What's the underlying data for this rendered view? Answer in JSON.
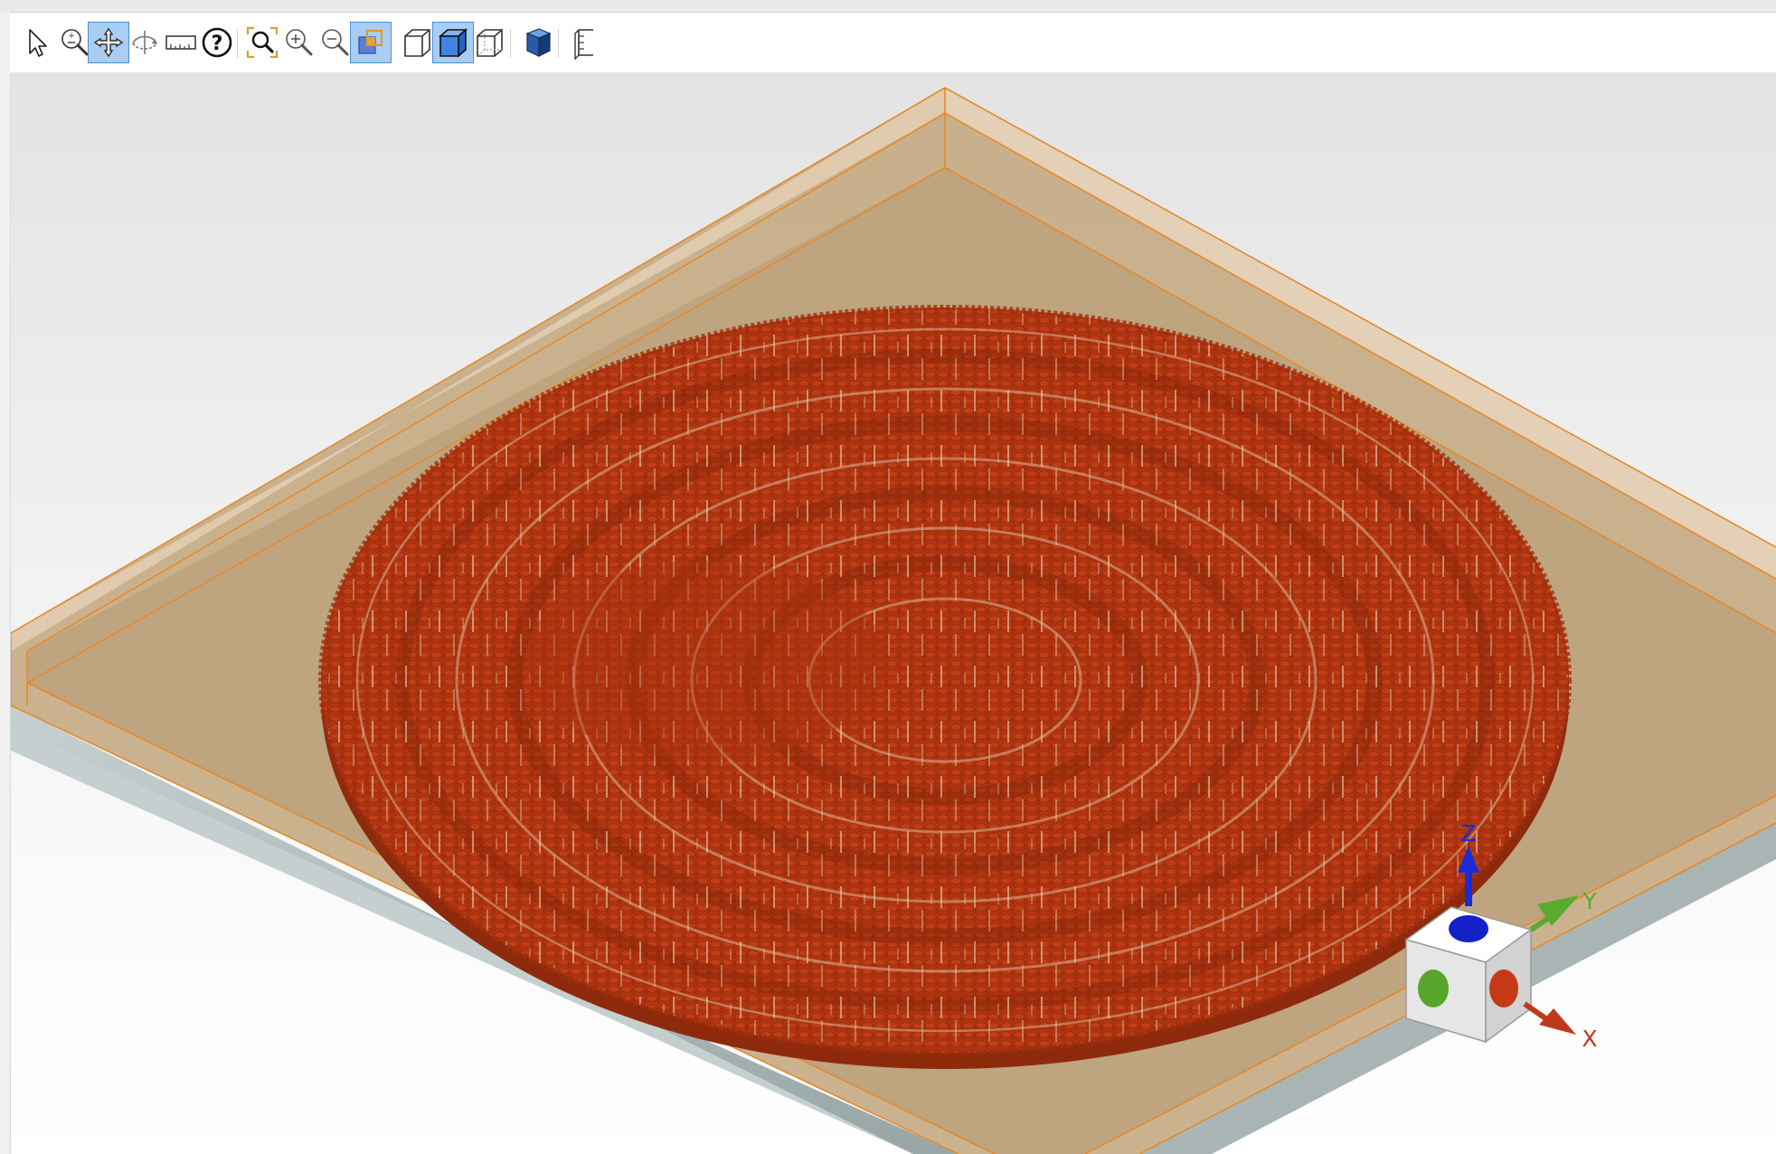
{
  "toolbar": {
    "buttons": [
      {
        "name": "select-tool-button",
        "icon": "arrow-pointer-icon",
        "active": false
      },
      {
        "name": "zoom-dynamic-button",
        "icon": "zoom-plus-minus-icon",
        "active": false
      },
      {
        "name": "pan-button",
        "icon": "pan-move-icon",
        "active": true
      },
      {
        "name": "rotate-button",
        "icon": "rotate-icon",
        "active": false
      },
      {
        "name": "measure-button",
        "icon": "ruler-icon",
        "active": false
      },
      {
        "name": "help-button",
        "icon": "help-icon",
        "active": false
      },
      {
        "name": "zoom-fit-button",
        "icon": "zoom-fit-icon",
        "active": false
      },
      {
        "name": "zoom-in-button",
        "icon": "zoom-in-icon",
        "active": false
      },
      {
        "name": "zoom-out-button",
        "icon": "zoom-out-icon",
        "active": false
      },
      {
        "name": "box-zoom-button",
        "icon": "box-select-icon",
        "active": true
      },
      {
        "name": "wireframe-view-button",
        "icon": "wireframe-cube-icon",
        "active": false
      },
      {
        "name": "shaded-view-button",
        "icon": "shaded-cube-icon",
        "active": true
      },
      {
        "name": "hidden-line-view-button",
        "icon": "hidden-line-cube-icon",
        "active": false
      },
      {
        "name": "solid-display-button",
        "icon": "solid-cube-icon",
        "active": false
      },
      {
        "name": "section-view-button",
        "icon": "section-plane-icon",
        "active": false
      }
    ]
  },
  "colors": {
    "accent_active": "#a9cdf3",
    "substrate_fill": "#c7ab85",
    "substrate_edge": "#e58a2a",
    "pillars": "#b53512",
    "base_plate": "#a9b5b5",
    "axis_x": "#c0391b",
    "axis_y": "#5aaa2f",
    "axis_z": "#1b2bd1"
  },
  "scene": {
    "description_icon": "3d-model-view",
    "triad": {
      "x_label": "X",
      "y_label": "Y",
      "z_label": "Z"
    }
  }
}
